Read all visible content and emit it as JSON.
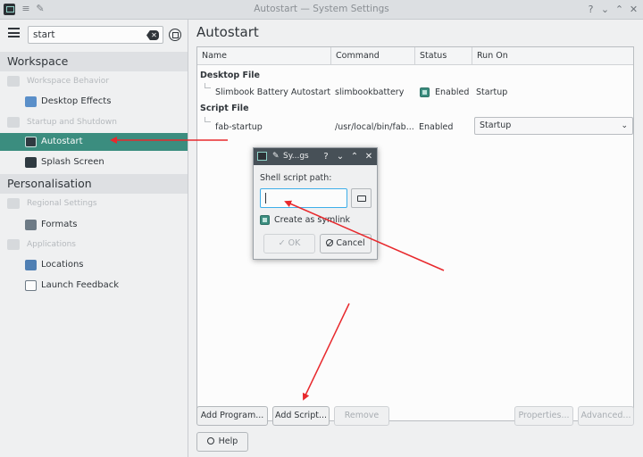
{
  "window": {
    "title": "Autostart — System Settings"
  },
  "search": {
    "value": "start"
  },
  "sidebar": {
    "sections": [
      {
        "label": "Workspace"
      },
      {
        "label": "Personalisation"
      }
    ],
    "categories": [
      {
        "label": "Workspace Behavior"
      },
      {
        "label": "Startup and Shutdown"
      },
      {
        "label": "Regional Settings"
      },
      {
        "label": "Applications"
      }
    ],
    "items": [
      {
        "label": "Desktop Effects"
      },
      {
        "label": "Autostart"
      },
      {
        "label": "Splash Screen"
      },
      {
        "label": "Formats"
      },
      {
        "label": "Locations"
      },
      {
        "label": "Launch Feedback"
      }
    ]
  },
  "main": {
    "title": "Autostart",
    "columns": [
      "Name",
      "Command",
      "Status",
      "Run On"
    ],
    "groups": [
      {
        "label": "Desktop File",
        "rows": [
          {
            "name": "Slimbook Battery Autostart",
            "command": "slimbookbattery",
            "status": "Enabled",
            "run_on": "Startup"
          }
        ]
      },
      {
        "label": "Script File",
        "rows": [
          {
            "name": "fab-startup",
            "command": "/usr/local/bin/fab...",
            "status": "Enabled",
            "run_on": "Startup"
          }
        ]
      }
    ],
    "buttons": {
      "add_program": "Add Program...",
      "add_script": "Add Script...",
      "remove": "Remove",
      "properties": "Properties...",
      "advanced": "Advanced...",
      "help": "Help"
    }
  },
  "dialog": {
    "title": "Sy...gs",
    "label": "Shell script path:",
    "path_value": "",
    "symlink_label": "Create as symlink",
    "symlink_checked": true,
    "ok": "OK",
    "cancel": "Cancel"
  },
  "colors": {
    "accent": "#3b8d7f",
    "annotation_arrow": "#e8292d",
    "focus": "#3daee9"
  }
}
